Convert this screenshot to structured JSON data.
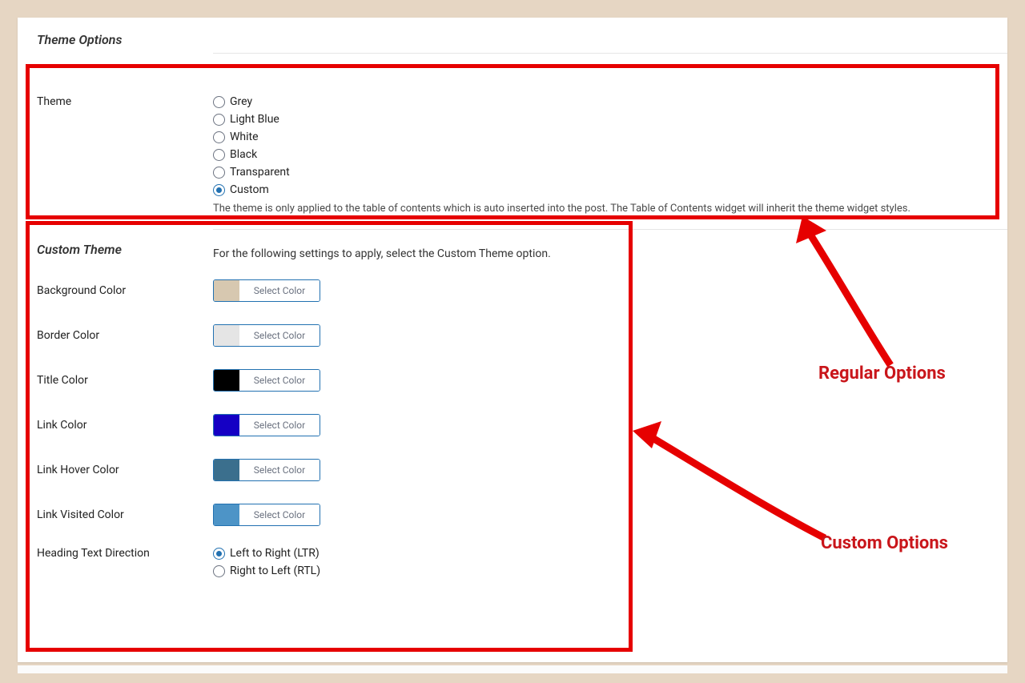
{
  "sections": {
    "theme_options_title": "Theme Options",
    "custom_theme_title": "Custom Theme"
  },
  "theme": {
    "label": "Theme",
    "options": [
      "Grey",
      "Light Blue",
      "White",
      "Black",
      "Transparent",
      "Custom"
    ],
    "selected": "Custom",
    "description": "The theme is only applied to the table of contents which is auto inserted into the post. The Table of Contents widget will inherit the theme widget styles."
  },
  "custom": {
    "intro": "For the following settings to apply, select the Custom Theme option.",
    "select_color_label": "Select Color",
    "fields": {
      "background_color": {
        "label": "Background Color",
        "swatch": "#d7c8b0"
      },
      "border_color": {
        "label": "Border Color",
        "swatch": "#e5e5e5"
      },
      "title_color": {
        "label": "Title Color",
        "swatch": "#000000"
      },
      "link_color": {
        "label": "Link Color",
        "swatch": "#1500c4"
      },
      "link_hover_color": {
        "label": "Link Hover Color",
        "swatch": "#3b6f8d"
      },
      "link_visited_color": {
        "label": "Link Visited Color",
        "swatch": "#4d94c7"
      }
    },
    "heading_direction": {
      "label": "Heading Text Direction",
      "options": [
        "Left to Right (LTR)",
        "Right to Left (RTL)"
      ],
      "selected": "Left to Right (LTR)"
    }
  },
  "annotations": {
    "regular": "Regular Options",
    "custom": "Custom Options"
  }
}
